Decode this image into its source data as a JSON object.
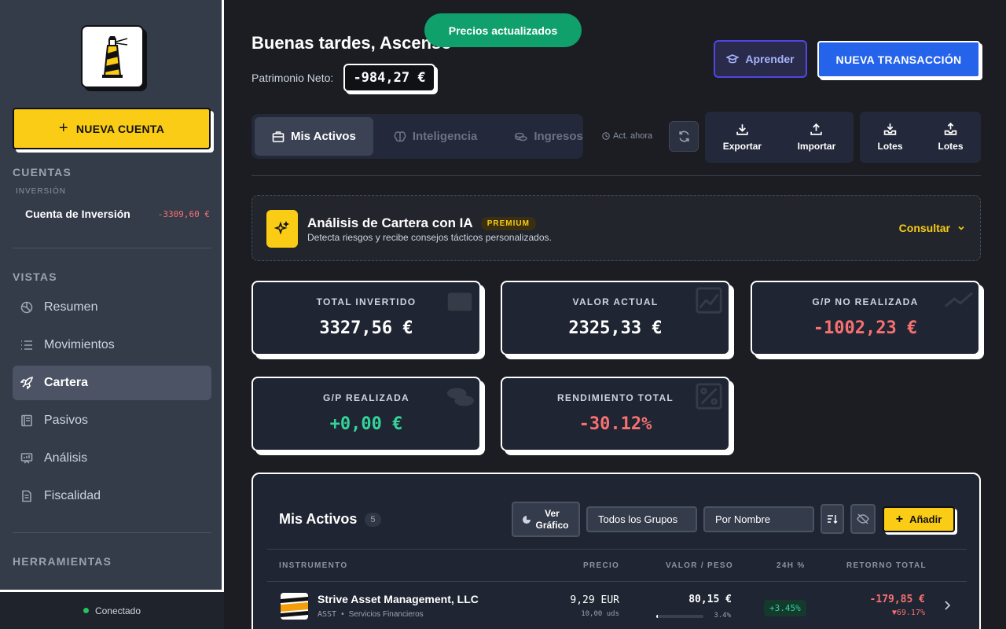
{
  "toast": "Precios actualizados",
  "sidebar": {
    "new_account": "NUEVA CUENTA",
    "section_accounts": "CUENTAS",
    "group_investment": "INVERSIÓN",
    "account_name": "Cuenta de Inversión",
    "account_balance": "-3309,60 €",
    "section_views": "VISTAS",
    "nav": [
      {
        "label": "Resumen",
        "icon": "pie-chart-icon"
      },
      {
        "label": "Movimientos",
        "icon": "list-icon"
      },
      {
        "label": "Cartera",
        "icon": "rocket-icon",
        "active": true
      },
      {
        "label": "Pasivos",
        "icon": "book-icon"
      },
      {
        "label": "Análisis",
        "icon": "presentation-icon"
      },
      {
        "label": "Fiscalidad",
        "icon": "document-icon"
      }
    ],
    "section_tools": "HERRAMIENTAS",
    "status": "Conectado"
  },
  "header": {
    "greeting": "Buenas tardes, Ascenso",
    "net_worth_label": "Patrimonio Neto:",
    "net_worth_value": "-984,27 €",
    "learn": "Aprender",
    "new_transaction": "NUEVA TRANSACCIÓN"
  },
  "tabs": [
    {
      "label": "Mis Activos",
      "active": true
    },
    {
      "label": "Inteligencia"
    },
    {
      "label": "Ingresos"
    }
  ],
  "updated": "Act. ahora",
  "actions": [
    {
      "label": "Exportar",
      "icon": "download-icon"
    },
    {
      "label": "Importar",
      "icon": "upload-icon"
    },
    {
      "label": "Lotes",
      "icon": "tray-download-icon"
    },
    {
      "label": "Lotes",
      "icon": "tray-upload-icon"
    }
  ],
  "ai": {
    "title": "Análisis de Cartera con IA",
    "badge": "PREMIUM",
    "description": "Detecta riesgos y recibe consejos tácticos personalizados.",
    "consult": "Consultar"
  },
  "stats": [
    {
      "label": "TOTAL INVERTIDO",
      "value": "3327,56 €",
      "tone": "neutral"
    },
    {
      "label": "VALOR ACTUAL",
      "value": "2325,33 €",
      "tone": "neutral"
    },
    {
      "label": "G/P NO REALIZADA",
      "value": "-1002,23 €",
      "tone": "neg"
    },
    {
      "label": "G/P REALIZADA",
      "value": "+0,00 €",
      "tone": "pos"
    },
    {
      "label": "RENDIMIENTO TOTAL",
      "value": "-30.12%",
      "tone": "neg"
    }
  ],
  "assets": {
    "title": "Mis Activos",
    "count": "5",
    "chart_btn_1": "Ver",
    "chart_btn_2": "Gráfico",
    "group_select": "Todos los Grupos",
    "sort_select": "Por Nombre",
    "add": "Añadir",
    "columns": [
      "INSTRUMENTO",
      "PRECIO",
      "VALOR / PESO",
      "24H %",
      "RETORNO TOTAL"
    ],
    "rows": [
      {
        "name": "Strive Asset Management, LLC",
        "ticker": "ASST",
        "sector": "Servicios Financieros",
        "price": "9,29 EUR",
        "units": "10,00 uds",
        "value": "80,15 €",
        "weight": "3.4%",
        "weight_fraction": 0.034,
        "change_24h": "+3.45%",
        "return": "-179,85 €",
        "return_pct": "▼69.17%"
      }
    ]
  }
}
